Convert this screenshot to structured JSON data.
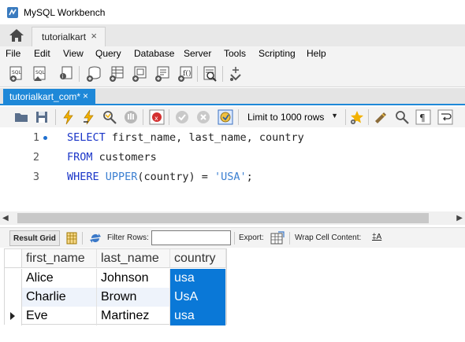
{
  "window": {
    "title": "MySQL Workbench"
  },
  "connection_tab": {
    "label": "tutorialkart",
    "close": "×"
  },
  "menu": [
    "File",
    "Edit",
    "View",
    "Query",
    "Database",
    "Server",
    "Tools",
    "Scripting",
    "Help"
  ],
  "editor_tab": {
    "label": "tutorialkart_com*",
    "close": "×"
  },
  "sql_toolbar": {
    "limit_label": "Limit to 1000 rows"
  },
  "editor": {
    "line_numbers": [
      "1",
      "2",
      "3"
    ],
    "lines": [
      {
        "kw": "SELECT",
        "rest": " first_name, last_name, country"
      },
      {
        "kw": "FROM",
        "rest": " customers"
      },
      {
        "kw": "WHERE",
        "fn": " UPPER",
        "mid": "(country) = ",
        "str": "'USA'",
        "end": ";"
      }
    ]
  },
  "result_toolbar": {
    "result_grid": "Result Grid",
    "filter_rows": "Filter Rows:",
    "filter_value": "",
    "export": "Export:",
    "wrap_cell": "Wrap Cell Content:",
    "wrap_icon_text": "‡A"
  },
  "grid": {
    "columns": [
      "first_name",
      "last_name",
      "country"
    ],
    "rows": [
      [
        "Alice",
        "Johnson",
        "usa"
      ],
      [
        "Charlie",
        "Brown",
        "UsA"
      ],
      [
        "Eve",
        "Martinez",
        "usa"
      ]
    ]
  },
  "colors": {
    "accent": "#1e88d8",
    "keyword": "#1a35c8",
    "selection": "#0a78d7"
  }
}
